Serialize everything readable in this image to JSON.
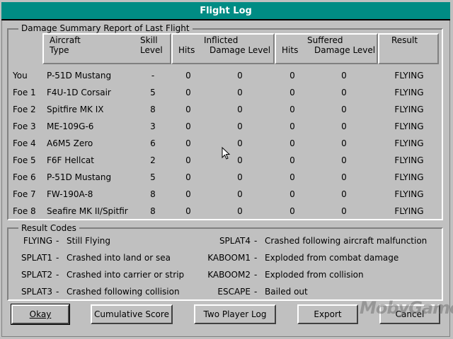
{
  "window": {
    "title": "Flight Log"
  },
  "summary": {
    "legend": "Damage Summary Report of Last Flight",
    "headers": {
      "aircraft_line1": "Aircraft",
      "aircraft_line2": "Type",
      "skill_line1": "Skill",
      "skill_line2": "Level",
      "inflicted": "Inflicted",
      "inflicted_hits": "Hits",
      "inflicted_damage": "Damage Level",
      "suffered": "Suffered",
      "suffered_hits": "Hits",
      "suffered_damage": "Damage Level",
      "result": "Result"
    },
    "rows": [
      {
        "pilot": "You",
        "aircraft": "P-51D Mustang",
        "skill": "-",
        "inf_hits": "0",
        "inf_dmg": "0",
        "suf_hits": "0",
        "suf_dmg": "0",
        "result": "FLYING"
      },
      {
        "pilot": "Foe 1",
        "aircraft": "F4U-1D Corsair",
        "skill": "5",
        "inf_hits": "0",
        "inf_dmg": "0",
        "suf_hits": "0",
        "suf_dmg": "0",
        "result": "FLYING"
      },
      {
        "pilot": "Foe 2",
        "aircraft": "Spitfire MK IX",
        "skill": "8",
        "inf_hits": "0",
        "inf_dmg": "0",
        "suf_hits": "0",
        "suf_dmg": "0",
        "result": "FLYING"
      },
      {
        "pilot": "Foe 3",
        "aircraft": "ME-109G-6",
        "skill": "3",
        "inf_hits": "0",
        "inf_dmg": "0",
        "suf_hits": "0",
        "suf_dmg": "0",
        "result": "FLYING"
      },
      {
        "pilot": "Foe 4",
        "aircraft": "A6M5 Zero",
        "skill": "6",
        "inf_hits": "0",
        "inf_dmg": "0",
        "suf_hits": "0",
        "suf_dmg": "0",
        "result": "FLYING"
      },
      {
        "pilot": "Foe 5",
        "aircraft": "F6F Hellcat",
        "skill": "2",
        "inf_hits": "0",
        "inf_dmg": "0",
        "suf_hits": "0",
        "suf_dmg": "0",
        "result": "FLYING"
      },
      {
        "pilot": "Foe 6",
        "aircraft": "P-51D Mustang",
        "skill": "5",
        "inf_hits": "0",
        "inf_dmg": "0",
        "suf_hits": "0",
        "suf_dmg": "0",
        "result": "FLYING"
      },
      {
        "pilot": "Foe 7",
        "aircraft": "FW-190A-8",
        "skill": "8",
        "inf_hits": "0",
        "inf_dmg": "0",
        "suf_hits": "0",
        "suf_dmg": "0",
        "result": "FLYING"
      },
      {
        "pilot": "Foe 8",
        "aircraft": "Seafire MK II/Spitfir",
        "skill": "8",
        "inf_hits": "0",
        "inf_dmg": "0",
        "suf_hits": "0",
        "suf_dmg": "0",
        "result": "FLYING"
      }
    ]
  },
  "result_codes": {
    "legend": "Result Codes",
    "left": [
      {
        "code": "FLYING",
        "desc": "Still Flying"
      },
      {
        "code": "SPLAT1",
        "desc": "Crashed into land or sea"
      },
      {
        "code": "SPLAT2",
        "desc": "Crashed into carrier or strip"
      },
      {
        "code": "SPLAT3",
        "desc": "Crashed following collision"
      }
    ],
    "right": [
      {
        "code": "SPLAT4",
        "desc": "Crashed following aircraft malfunction"
      },
      {
        "code": "KABOOM1",
        "desc": "Exploded from combat damage"
      },
      {
        "code": "KABOOM2",
        "desc": "Exploded from collision"
      },
      {
        "code": "ESCAPE",
        "desc": "Bailed out"
      }
    ],
    "separator": "-"
  },
  "buttons": {
    "okay": "Okay",
    "cumulative": "Cumulative Score",
    "two_player": "Two Player Log",
    "export": "Export",
    "cancel": "Cancel"
  },
  "watermark": "MobyGames"
}
